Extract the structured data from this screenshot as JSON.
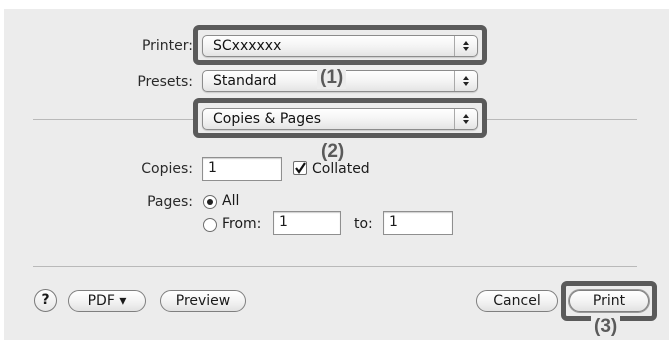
{
  "printer": {
    "label": "Printer:",
    "value": "SCxxxxxx"
  },
  "presets": {
    "label": "Presets:",
    "value": "Standard"
  },
  "panel": {
    "value": "Copies & Pages"
  },
  "callouts": {
    "c1": "(1)",
    "c2": "(2)",
    "c3": "(3)"
  },
  "copies": {
    "label": "Copies:",
    "value": "1",
    "collated_label": "Collated",
    "collated_checked": true
  },
  "pages": {
    "label": "Pages:",
    "all_label": "All",
    "from_label": "From:",
    "from_value": "1",
    "to_label": "to:",
    "to_value": "1",
    "selected": "All"
  },
  "buttons": {
    "help": "?",
    "pdf": "PDF ▾",
    "preview": "Preview",
    "cancel": "Cancel",
    "print": "Print"
  }
}
